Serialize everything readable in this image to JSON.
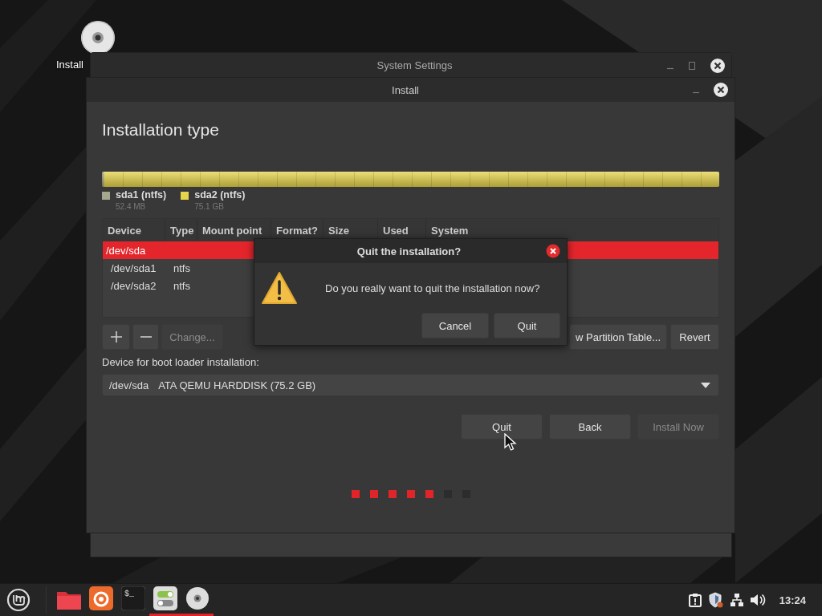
{
  "desktop": {
    "icons": [
      {
        "label": "Install"
      }
    ]
  },
  "settings_window": {
    "title": "System Settings"
  },
  "install_window": {
    "title": "Install",
    "heading": "Installation type",
    "partitions": [
      {
        "name": "sda1 (ntfs)",
        "size": "52.4 MB",
        "color": "#a3a891"
      },
      {
        "name": "sda2 (ntfs)",
        "size": "75.1 GB",
        "color": "#e6d44a"
      }
    ],
    "table": {
      "columns": [
        "Device",
        "Type",
        "Mount point",
        "Format?",
        "Size",
        "Used",
        "System"
      ],
      "rows": [
        {
          "cells": [
            "/dev/sda"
          ],
          "selected": true
        },
        {
          "cells": [
            "/dev/sda1",
            "ntfs"
          ],
          "selected": false
        },
        {
          "cells": [
            "/dev/sda2",
            "ntfs"
          ],
          "selected": false
        }
      ]
    },
    "partition_buttons": [
      {
        "kind": "add",
        "disabled": false
      },
      {
        "kind": "remove",
        "disabled": false
      },
      {
        "kind": "text",
        "label": "Change...",
        "disabled": true
      }
    ],
    "table_buttons": [
      {
        "label": "w Partition Table...",
        "disabled": false
      },
      {
        "label": "Revert",
        "disabled": false
      }
    ],
    "boot_loader": {
      "label": "Device for boot loader installation:",
      "device": "/dev/sda",
      "description": "ATA QEMU HARDDISK (75.2 GB)"
    },
    "buttons": [
      {
        "label": "Quit",
        "disabled": false
      },
      {
        "label": "Back",
        "disabled": false
      },
      {
        "label": "Install Now",
        "disabled": true
      }
    ],
    "steps": [
      {
        "done": true
      },
      {
        "done": true
      },
      {
        "done": true
      },
      {
        "done": true
      },
      {
        "done": true
      },
      {
        "done": false
      },
      {
        "done": false
      }
    ]
  },
  "dialog": {
    "title": "Quit the installation?",
    "message": "Do you really want to quit the installation now?",
    "buttons": [
      {
        "label": "Cancel"
      },
      {
        "label": "Quit"
      }
    ]
  },
  "taskbar": {
    "launchers": [
      {
        "kind": "folder",
        "running": false
      },
      {
        "kind": "browser",
        "running": false
      },
      {
        "kind": "terminal",
        "text": "$_",
        "running": false
      },
      {
        "kind": "settings",
        "running": true
      },
      {
        "kind": "disc",
        "running": true
      }
    ],
    "tray": [
      {
        "kind": "clipboard"
      },
      {
        "kind": "shield"
      },
      {
        "kind": "network"
      },
      {
        "kind": "volume"
      }
    ],
    "clock": "13:24"
  }
}
